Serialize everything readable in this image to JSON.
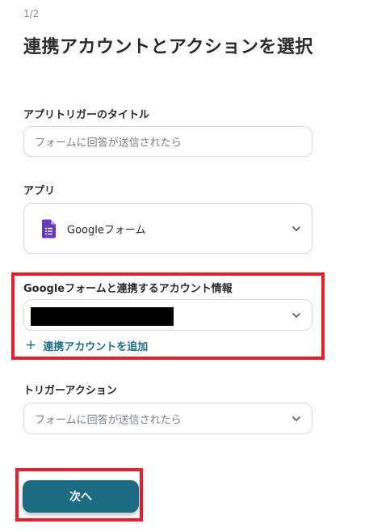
{
  "header": {
    "step_indicator": "1/2",
    "title": "連携アカウントとアクションを選択"
  },
  "trigger_title": {
    "label": "アプリトリガーのタイトル",
    "value": "フォームに回答が送信されたら"
  },
  "app": {
    "label": "アプリ",
    "selected": "Googleフォーム",
    "icon": "google-forms-icon"
  },
  "account": {
    "label": "Googleフォームと連携するアカウント情報",
    "value_masked": true,
    "add_link_label": "連携アカウントを追加"
  },
  "trigger_action": {
    "label": "トリガーアクション",
    "selected": "フォームに回答が送信されたら"
  },
  "footer": {
    "next_label": "次へ"
  },
  "colors": {
    "accent": "#1b6b83",
    "link": "#1e6f86",
    "highlight": "#e3212c",
    "forms_purple": "#673ab7"
  }
}
